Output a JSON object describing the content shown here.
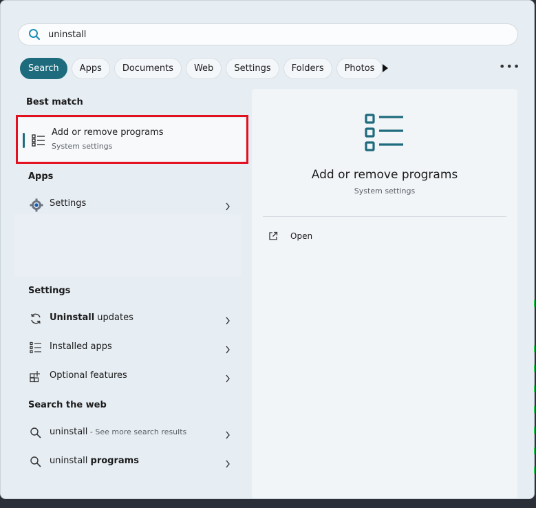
{
  "search": {
    "value": "uninstall"
  },
  "filters": [
    "Search",
    "Apps",
    "Documents",
    "Web",
    "Settings",
    "Folders",
    "Photos"
  ],
  "best_match": {
    "heading": "Best match",
    "title": "Add or remove programs",
    "subtitle": "System settings"
  },
  "apps": {
    "heading": "Apps",
    "items": [
      {
        "label": "Settings",
        "icon": "gear-icon"
      }
    ]
  },
  "settings": {
    "heading": "Settings",
    "items": [
      {
        "bold": "Uninstall",
        "rest": " updates",
        "icon": "refresh-icon"
      },
      {
        "label": "Installed apps",
        "icon": "list-icon"
      },
      {
        "label": "Optional features",
        "icon": "add-grid-icon"
      }
    ]
  },
  "web": {
    "heading": "Search the web",
    "items": [
      {
        "label": "uninstall",
        "suffix": " - See more search results",
        "icon": "search-icon"
      },
      {
        "label": "uninstall ",
        "bold": "programs",
        "icon": "search-icon"
      }
    ]
  },
  "preview": {
    "title": "Add or remove programs",
    "subtitle": "System settings",
    "actions": [
      {
        "label": "Open",
        "icon": "open-external-icon"
      }
    ]
  },
  "colors": {
    "accent": "#1d6b7d",
    "highlight": "#e3101f"
  }
}
